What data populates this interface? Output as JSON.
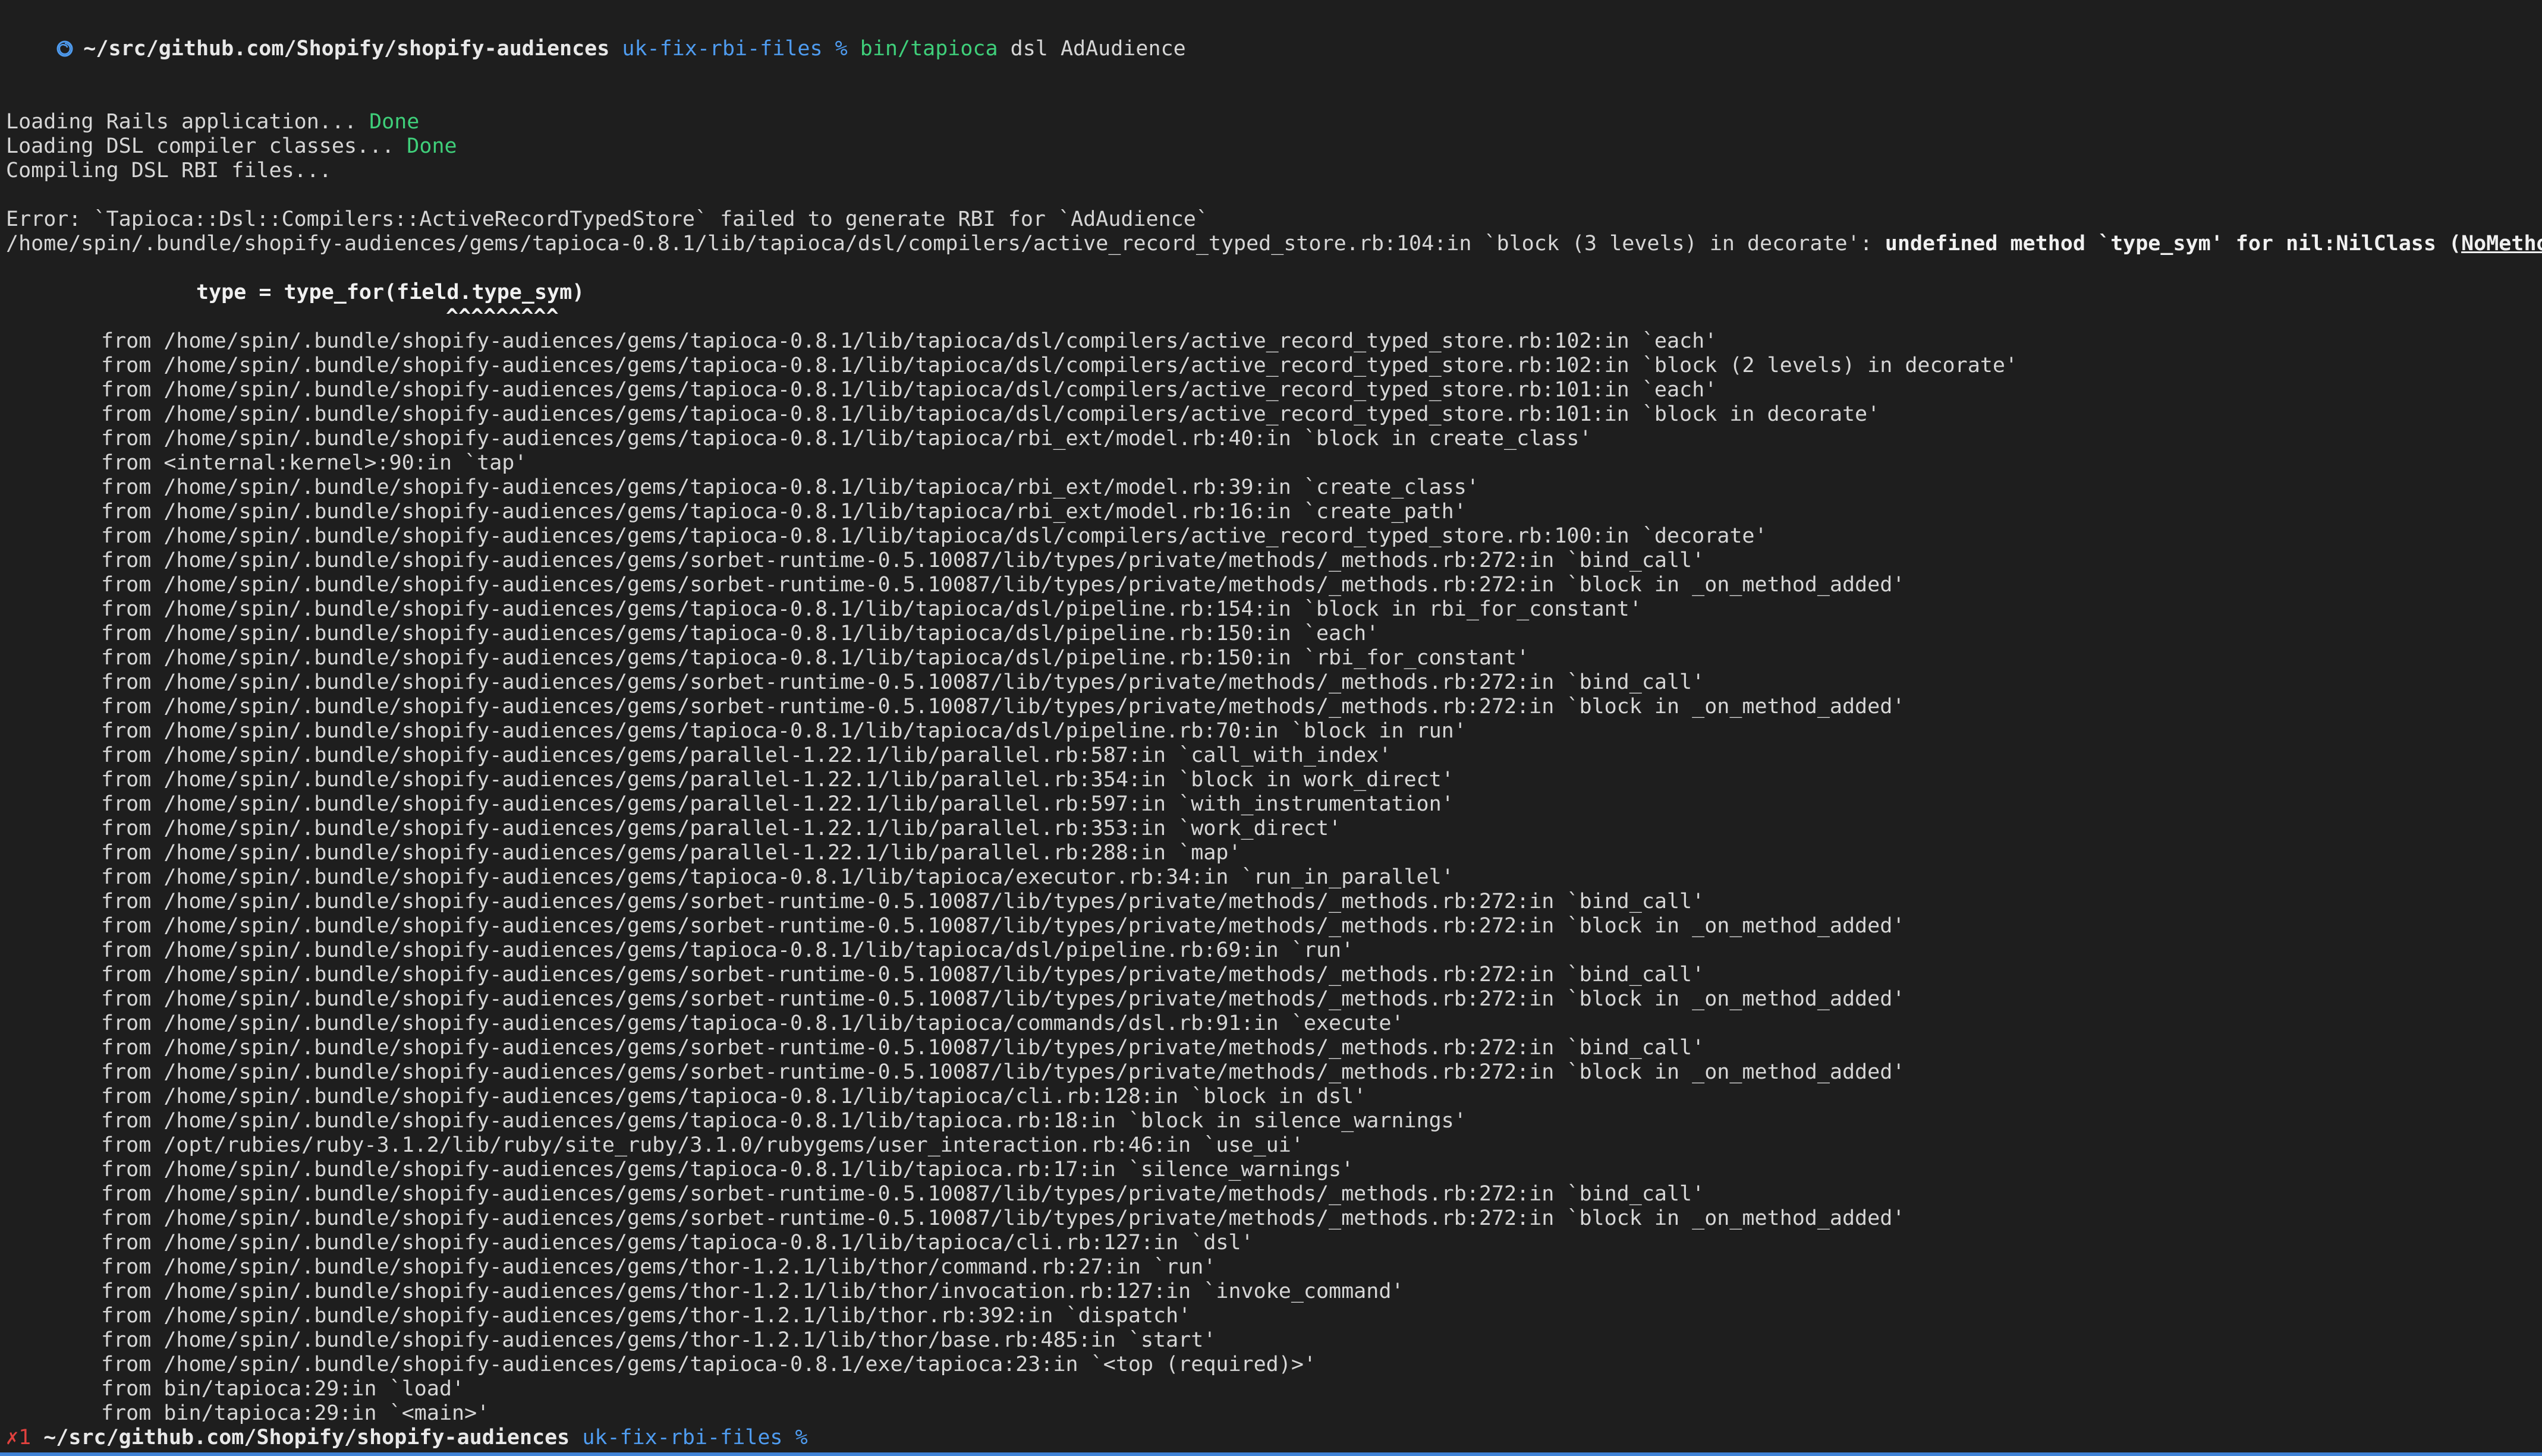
{
  "prompt": {
    "path": "~/src/github.com/Shopify/shopify-audiences",
    "branch": "uk-fix-rbi-files",
    "symbol": "%",
    "command_bin": "bin/tapioca",
    "command_args": "dsl AdAudience",
    "exit_status": "✗1"
  },
  "status_lines": [
    {
      "text": "Loading Rails application... ",
      "status": "Done"
    },
    {
      "text": "Loading DSL compiler classes... ",
      "status": "Done"
    },
    {
      "text": "Compiling DSL RBI files...",
      "status": ""
    }
  ],
  "error": {
    "message": "Error: `Tapioca::Dsl::Compilers::ActiveRecordTypedStore` failed to generate RBI for `AdAudience`",
    "location": "/home/spin/.bundle/shopify-audiences/gems/tapioca-0.8.1/lib/tapioca/dsl/compilers/active_record_typed_store.rb:104:in `block (3 levels) in decorate': ",
    "detail": "undefined method `type_sym' for nil:NilClass (",
    "exception_class": "NoMethodError",
    "closing": ")",
    "source_line": "type = type_for(field.type_sym)",
    "caret": "^^^^^^^^^"
  },
  "backtrace": [
    "from /home/spin/.bundle/shopify-audiences/gems/tapioca-0.8.1/lib/tapioca/dsl/compilers/active_record_typed_store.rb:102:in `each'",
    "from /home/spin/.bundle/shopify-audiences/gems/tapioca-0.8.1/lib/tapioca/dsl/compilers/active_record_typed_store.rb:102:in `block (2 levels) in decorate'",
    "from /home/spin/.bundle/shopify-audiences/gems/tapioca-0.8.1/lib/tapioca/dsl/compilers/active_record_typed_store.rb:101:in `each'",
    "from /home/spin/.bundle/shopify-audiences/gems/tapioca-0.8.1/lib/tapioca/dsl/compilers/active_record_typed_store.rb:101:in `block in decorate'",
    "from /home/spin/.bundle/shopify-audiences/gems/tapioca-0.8.1/lib/tapioca/rbi_ext/model.rb:40:in `block in create_class'",
    "from <internal:kernel>:90:in `tap'",
    "from /home/spin/.bundle/shopify-audiences/gems/tapioca-0.8.1/lib/tapioca/rbi_ext/model.rb:39:in `create_class'",
    "from /home/spin/.bundle/shopify-audiences/gems/tapioca-0.8.1/lib/tapioca/rbi_ext/model.rb:16:in `create_path'",
    "from /home/spin/.bundle/shopify-audiences/gems/tapioca-0.8.1/lib/tapioca/dsl/compilers/active_record_typed_store.rb:100:in `decorate'",
    "from /home/spin/.bundle/shopify-audiences/gems/sorbet-runtime-0.5.10087/lib/types/private/methods/_methods.rb:272:in `bind_call'",
    "from /home/spin/.bundle/shopify-audiences/gems/sorbet-runtime-0.5.10087/lib/types/private/methods/_methods.rb:272:in `block in _on_method_added'",
    "from /home/spin/.bundle/shopify-audiences/gems/tapioca-0.8.1/lib/tapioca/dsl/pipeline.rb:154:in `block in rbi_for_constant'",
    "from /home/spin/.bundle/shopify-audiences/gems/tapioca-0.8.1/lib/tapioca/dsl/pipeline.rb:150:in `each'",
    "from /home/spin/.bundle/shopify-audiences/gems/tapioca-0.8.1/lib/tapioca/dsl/pipeline.rb:150:in `rbi_for_constant'",
    "from /home/spin/.bundle/shopify-audiences/gems/sorbet-runtime-0.5.10087/lib/types/private/methods/_methods.rb:272:in `bind_call'",
    "from /home/spin/.bundle/shopify-audiences/gems/sorbet-runtime-0.5.10087/lib/types/private/methods/_methods.rb:272:in `block in _on_method_added'",
    "from /home/spin/.bundle/shopify-audiences/gems/tapioca-0.8.1/lib/tapioca/dsl/pipeline.rb:70:in `block in run'",
    "from /home/spin/.bundle/shopify-audiences/gems/parallel-1.22.1/lib/parallel.rb:587:in `call_with_index'",
    "from /home/spin/.bundle/shopify-audiences/gems/parallel-1.22.1/lib/parallel.rb:354:in `block in work_direct'",
    "from /home/spin/.bundle/shopify-audiences/gems/parallel-1.22.1/lib/parallel.rb:597:in `with_instrumentation'",
    "from /home/spin/.bundle/shopify-audiences/gems/parallel-1.22.1/lib/parallel.rb:353:in `work_direct'",
    "from /home/spin/.bundle/shopify-audiences/gems/parallel-1.22.1/lib/parallel.rb:288:in `map'",
    "from /home/spin/.bundle/shopify-audiences/gems/tapioca-0.8.1/lib/tapioca/executor.rb:34:in `run_in_parallel'",
    "from /home/spin/.bundle/shopify-audiences/gems/sorbet-runtime-0.5.10087/lib/types/private/methods/_methods.rb:272:in `bind_call'",
    "from /home/spin/.bundle/shopify-audiences/gems/sorbet-runtime-0.5.10087/lib/types/private/methods/_methods.rb:272:in `block in _on_method_added'",
    "from /home/spin/.bundle/shopify-audiences/gems/tapioca-0.8.1/lib/tapioca/dsl/pipeline.rb:69:in `run'",
    "from /home/spin/.bundle/shopify-audiences/gems/sorbet-runtime-0.5.10087/lib/types/private/methods/_methods.rb:272:in `bind_call'",
    "from /home/spin/.bundle/shopify-audiences/gems/sorbet-runtime-0.5.10087/lib/types/private/methods/_methods.rb:272:in `block in _on_method_added'",
    "from /home/spin/.bundle/shopify-audiences/gems/tapioca-0.8.1/lib/tapioca/commands/dsl.rb:91:in `execute'",
    "from /home/spin/.bundle/shopify-audiences/gems/sorbet-runtime-0.5.10087/lib/types/private/methods/_methods.rb:272:in `bind_call'",
    "from /home/spin/.bundle/shopify-audiences/gems/sorbet-runtime-0.5.10087/lib/types/private/methods/_methods.rb:272:in `block in _on_method_added'",
    "from /home/spin/.bundle/shopify-audiences/gems/tapioca-0.8.1/lib/tapioca/cli.rb:128:in `block in dsl'",
    "from /home/spin/.bundle/shopify-audiences/gems/tapioca-0.8.1/lib/tapioca.rb:18:in `block in silence_warnings'",
    "from /opt/rubies/ruby-3.1.2/lib/ruby/site_ruby/3.1.0/rubygems/user_interaction.rb:46:in `use_ui'",
    "from /home/spin/.bundle/shopify-audiences/gems/tapioca-0.8.1/lib/tapioca.rb:17:in `silence_warnings'",
    "from /home/spin/.bundle/shopify-audiences/gems/sorbet-runtime-0.5.10087/lib/types/private/methods/_methods.rb:272:in `bind_call'",
    "from /home/spin/.bundle/shopify-audiences/gems/sorbet-runtime-0.5.10087/lib/types/private/methods/_methods.rb:272:in `block in _on_method_added'",
    "from /home/spin/.bundle/shopify-audiences/gems/tapioca-0.8.1/lib/tapioca/cli.rb:127:in `dsl'",
    "from /home/spin/.bundle/shopify-audiences/gems/thor-1.2.1/lib/thor/command.rb:27:in `run'",
    "from /home/spin/.bundle/shopify-audiences/gems/thor-1.2.1/lib/thor/invocation.rb:127:in `invoke_command'",
    "from /home/spin/.bundle/shopify-audiences/gems/thor-1.2.1/lib/thor.rb:392:in `dispatch'",
    "from /home/spin/.bundle/shopify-audiences/gems/thor-1.2.1/lib/thor/base.rb:485:in `start'",
    "from /home/spin/.bundle/shopify-audiences/gems/tapioca-0.8.1/exe/tapioca:23:in `<top (required)>'",
    "from bin/tapioca:29:in `load'",
    "from bin/tapioca:29:in `<main>'"
  ],
  "colors": {
    "background": "#1e1e1e",
    "text": "#d6d6d6",
    "branch": "#4f9cf0",
    "success": "#3fcf7a",
    "error": "#e0413e"
  },
  "icons": {
    "prompt_icon": "spiral-prompt-icon"
  }
}
